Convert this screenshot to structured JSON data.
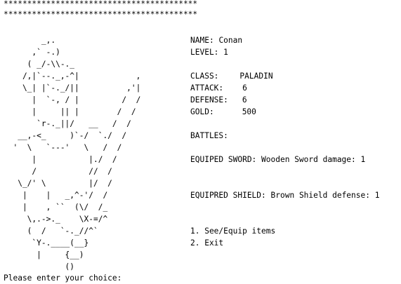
{
  "border": {
    "line1": "*****************************************",
    "line2": "*****************************************"
  },
  "ascii_art": "        _,.\n      ,` -.)\n     ( _/-\\\\-._\n    /,|`--._,-^|            ,\n    \\_| |`-._/||          ,'|\n      |  `-, / |         /  /\n      |     || |        /  /\n       `r-._||/   __   /  /\n   __,-<_     )`-/  `./  /\n  '  \\   `---'   \\   /  /\n      |           |./  /\n      /           //  /\n   \\_/' \\         |/  /\n    |    |   _,^-'/  /\n    |    , ``  (\\/  /_\n     \\,.->._    \\X-=/^\n     (  /   `-._//^`\n      `Y-.____(__}\n       |     {__)\n             ()",
  "character": {
    "name_label": "NAME:",
    "name": "Conan",
    "level_label": "LEVEL:",
    "level": "1",
    "class_label": "CLASS:",
    "class": "PALADIN",
    "attack_label": "ATTACK:",
    "attack": "6",
    "defense_label": "DEFENSE:",
    "defense": "6",
    "gold_label": "GOLD:",
    "gold": "500",
    "battles_label": "BATTLES:",
    "sword_label": "EQUIPED SWORD:",
    "sword": "Wooden Sword damage: 1",
    "shield_label": "EQUIPRED SHIELD:",
    "shield": "Brown Shield defense: 1"
  },
  "menu": {
    "item1": "1. See/Equip items",
    "item2": "2. Exit"
  },
  "prompt": "Please enter your choice:"
}
